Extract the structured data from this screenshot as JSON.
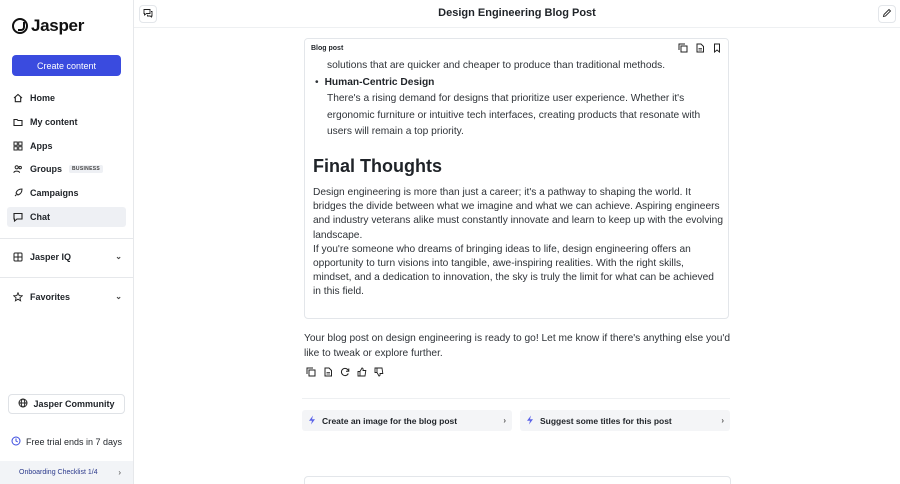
{
  "sidebar": {
    "logo_text": "Jasper",
    "create_button": "Create content",
    "nav": [
      {
        "label": "Home",
        "icon": "home-icon"
      },
      {
        "label": "My content",
        "icon": "folder-icon"
      },
      {
        "label": "Apps",
        "icon": "grid-icon"
      },
      {
        "label": "Groups",
        "icon": "users-icon",
        "badge": "BUSINESS"
      },
      {
        "label": "Campaigns",
        "icon": "rocket-icon"
      },
      {
        "label": "Chat",
        "icon": "chat-icon",
        "active": true
      }
    ],
    "jasper_iq": "Jasper IQ",
    "favorites": "Favorites",
    "community": "Jasper Community",
    "trial": "Free trial ends in 7 days",
    "checklist": "Onboarding Checklist 1/4"
  },
  "topbar": {
    "title": "Design Engineering Blog Post"
  },
  "doc": {
    "label": "Blog post",
    "line1": "solutions that are quicker and cheaper to produce than traditional methods.",
    "bullet_title": "Human-Centric Design",
    "bullet_body": "There's a rising demand for designs that prioritize user experience. Whether it's ergonomic furniture or intuitive tech interfaces, creating products that resonate with users will remain a top priority.",
    "heading": "Final Thoughts",
    "para1": "Design engineering is more than just a career; it's a pathway to shaping the world. It bridges the divide between what we imagine and what we can achieve. Aspiring engineers and industry veterans alike must constantly innovate and learn to keep up with the evolving landscape.",
    "para2": "If you're someone who dreams of bringing ideas to life, design engineering offers an opportunity to turn visions into tangible, awe-inspiring realities. With the right skills, mindset, and a dedication to innovation, the sky is truly the limit for what can be achieved in this field."
  },
  "reply": "Your blog post on design engineering is ready to go! Let me know if there's anything else you'd like to tweak or explore further.",
  "suggestions": [
    {
      "label": "Create an image for the blog post"
    },
    {
      "label": "Suggest some titles for this post"
    }
  ],
  "colors": {
    "accent": "#3a4bdf",
    "active_bg": "#eef0f4"
  }
}
